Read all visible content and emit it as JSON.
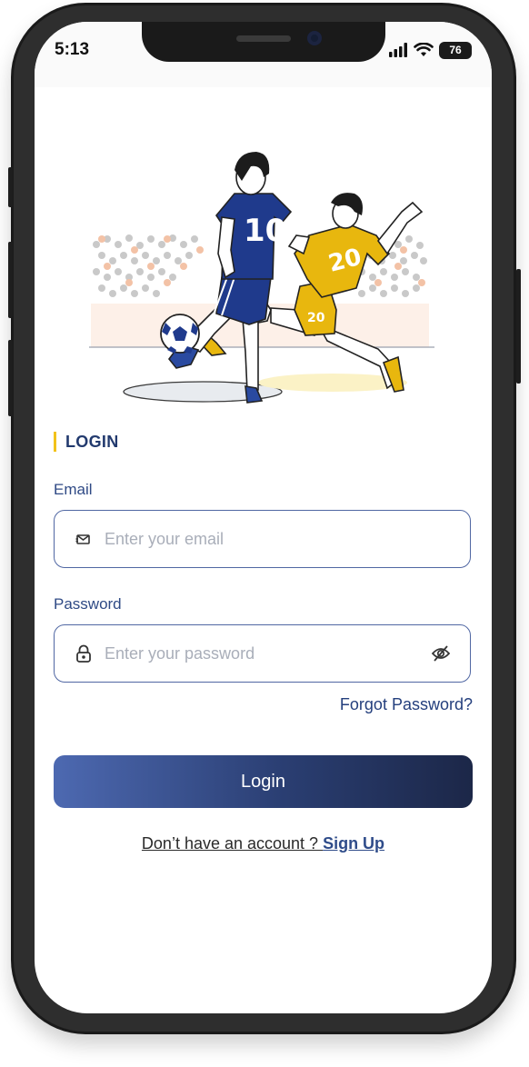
{
  "status_bar": {
    "time": "5:13",
    "battery": "76",
    "signal_icon": "signal-bars-icon",
    "wifi_icon": "wifi-icon"
  },
  "hero": {
    "player_blue_number": "10",
    "player_yellow_number": "20",
    "player_yellow_shorts_number": "20",
    "colors": {
      "blue_kit": "#1f3a8c",
      "yellow_kit": "#e8b70e",
      "crowd": "#c9c9c9",
      "crowd_accent": "#f3c2a6"
    }
  },
  "login": {
    "heading": "LOGIN",
    "accent_color": "#f2c21a",
    "email": {
      "label": "Email",
      "placeholder": "Enter your email",
      "icon": "mail-icon"
    },
    "password": {
      "label": "Password",
      "placeholder": "Enter your password",
      "icon": "lock-icon",
      "toggle_icon": "eye-off-icon"
    },
    "forgot_label": "Forgot Password?",
    "submit_label": "Login",
    "signup_prompt": "Don’t have an account ? ",
    "signup_label": "Sign Up",
    "brand_color": "#2f4c8a"
  }
}
